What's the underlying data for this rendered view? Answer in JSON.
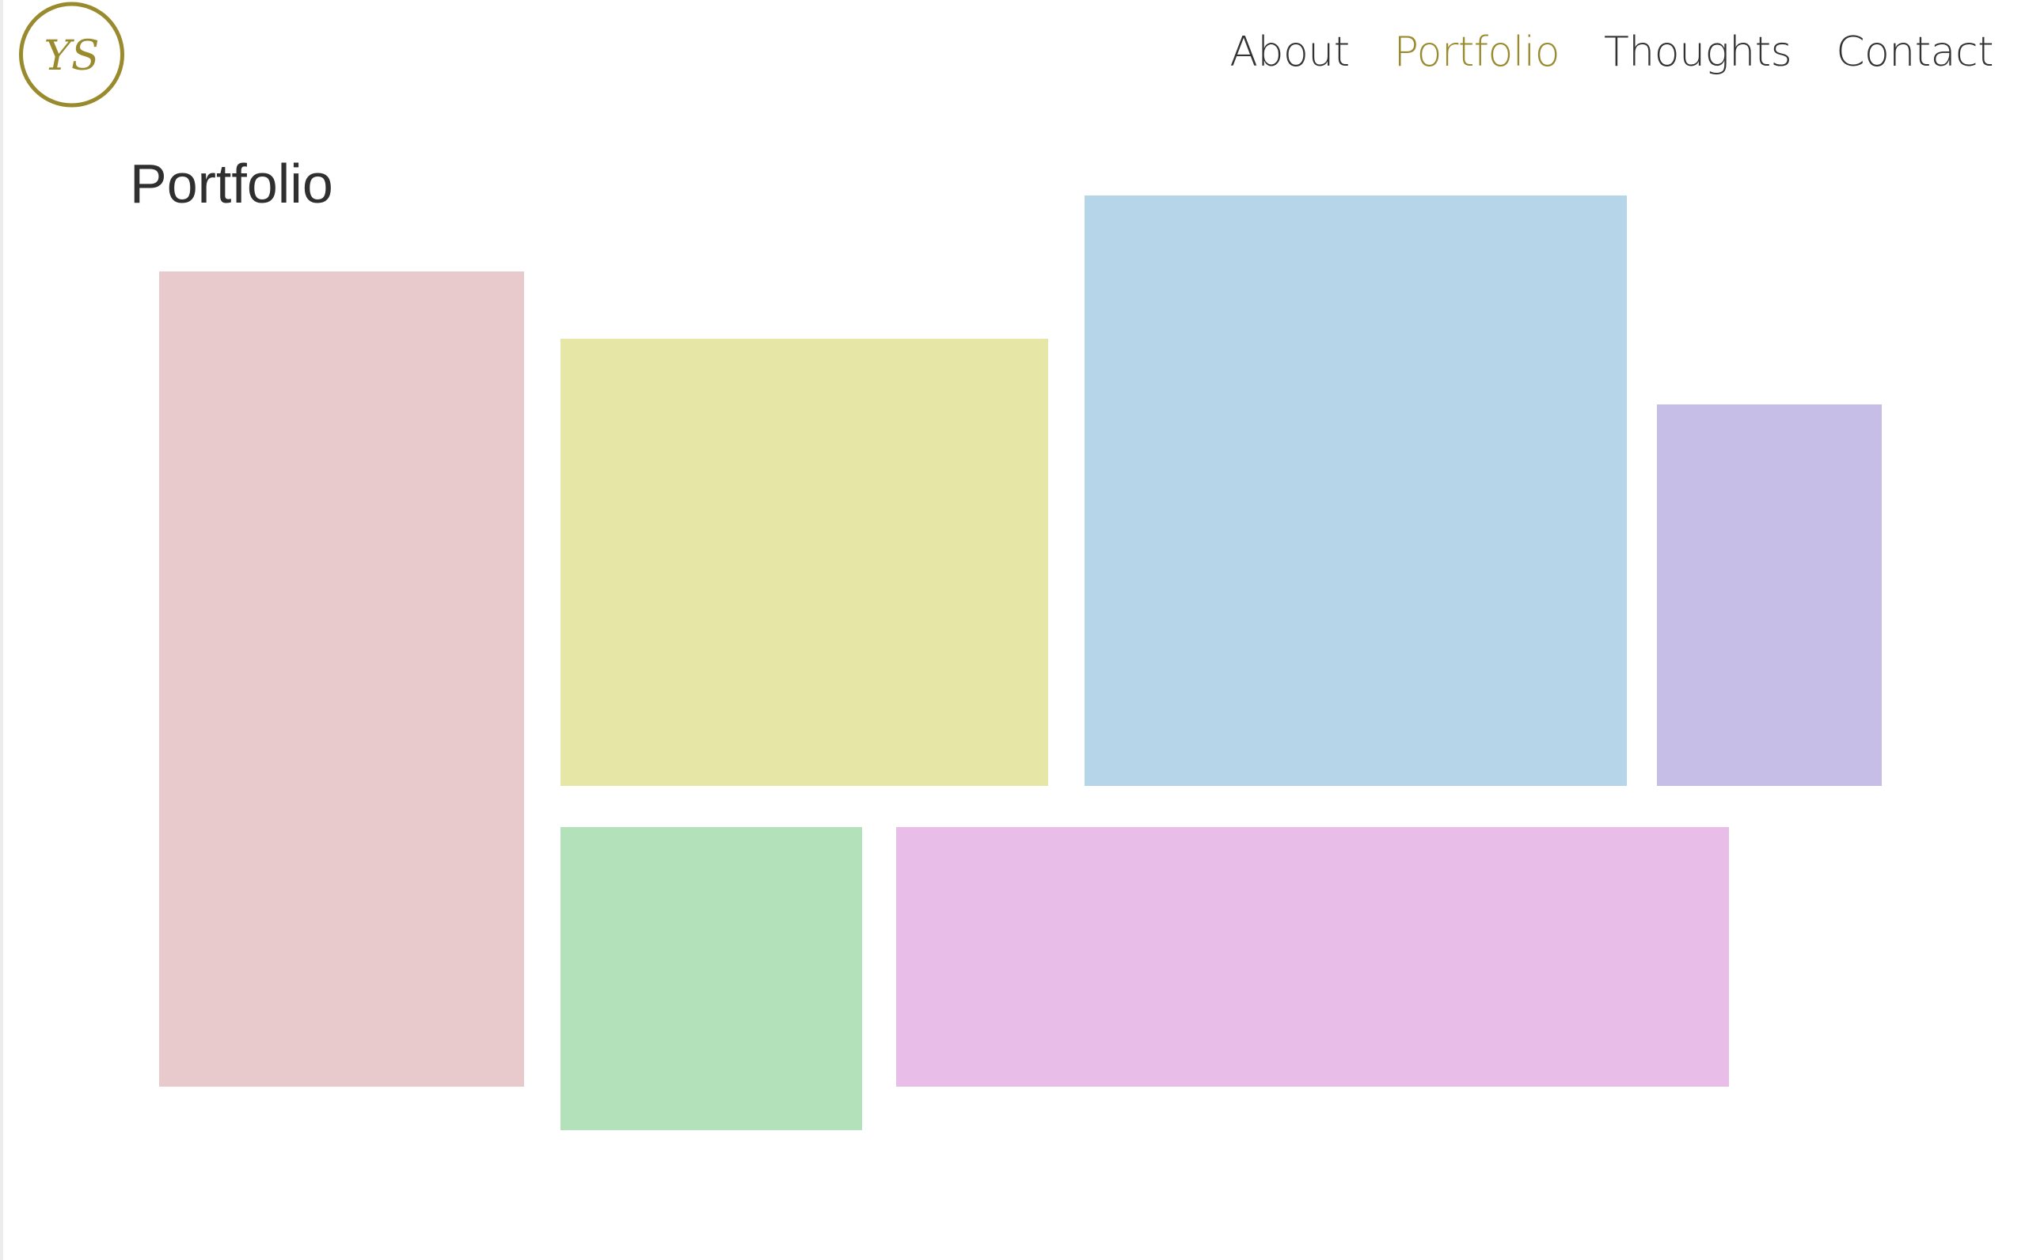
{
  "header": {
    "logo_text": "YS",
    "logo_color": "#9a8a2e",
    "nav": [
      {
        "label": "About",
        "active": false
      },
      {
        "label": "Portfolio",
        "active": true
      },
      {
        "label": "Thoughts",
        "active": false
      },
      {
        "label": "Contact",
        "active": false
      }
    ],
    "active_color": "#9a8a2e",
    "text_color": "#333333"
  },
  "main": {
    "title": "Portfolio",
    "tiles": [
      {
        "color": "#e8c9cc"
      },
      {
        "color": "#e6e6a7"
      },
      {
        "color": "#b6d5e8"
      },
      {
        "color": "#c6bee7"
      },
      {
        "color": "#b2e1ba"
      },
      {
        "color": "#e8bee8"
      }
    ]
  }
}
